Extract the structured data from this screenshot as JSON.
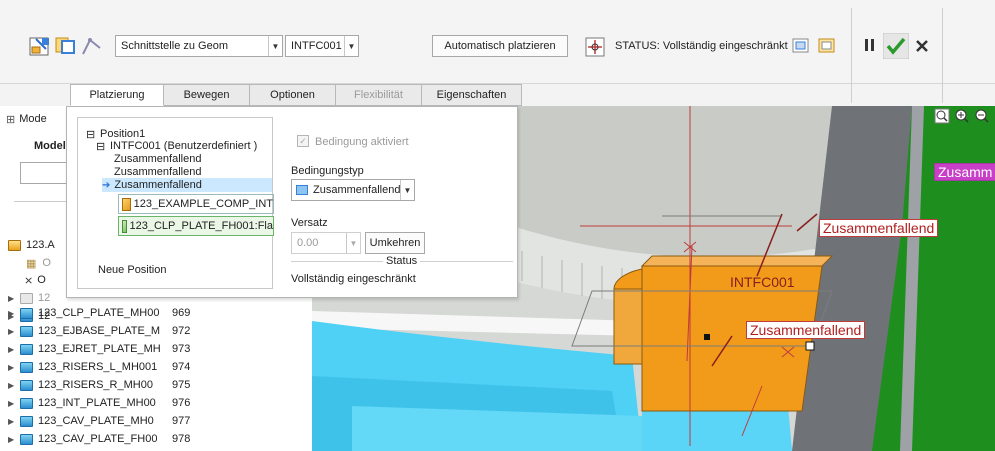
{
  "toolbar": {
    "interface_select": "Schnittstelle zu Geom",
    "intfc_select": "INTFC001",
    "auto_place_label": "Automatisch platzieren",
    "status_label": "STATUS: Vollständig eingeschränkt"
  },
  "tabs": [
    {
      "label": "Platzierung"
    },
    {
      "label": "Bewegen"
    },
    {
      "label": "Optionen"
    },
    {
      "label": "Flexibilität"
    },
    {
      "label": "Eigenschaften"
    }
  ],
  "left_panel": {
    "title_prefix": "Mode",
    "subtitle_prefix": "Model",
    "top_rows": [
      "123.A",
      "O",
      "O",
      "12",
      "12"
    ],
    "rows": [
      {
        "name": "123_CLP_PLATE_MH00",
        "num": "969"
      },
      {
        "name": "123_EJBASE_PLATE_M",
        "num": "972"
      },
      {
        "name": "123_EJRET_PLATE_MH",
        "num": "973"
      },
      {
        "name": "123_RISERS_L_MH001",
        "num": "974"
      },
      {
        "name": "123_RISERS_R_MH00",
        "num": "975"
      },
      {
        "name": "123_INT_PLATE_MH00",
        "num": "976"
      },
      {
        "name": "123_CAV_PLATE_MH0",
        "num": "977"
      },
      {
        "name": "123_CAV_PLATE_FH00",
        "num": "978"
      }
    ]
  },
  "placement": {
    "tree": {
      "position": "Position1",
      "interface": "INTFC001 (Benutzerdefiniert )",
      "constraint1": "Zusammenfallend",
      "constraint2": "Zusammenfallend",
      "constraint3": "Zusammenfallend",
      "ref1": "123_EXAMPLE_COMP_INT",
      "ref2": "123_CLP_PLATE_FH001:Fla",
      "new_position": "Neue Position"
    },
    "constraint_enabled_label": "Bedingung aktiviert",
    "constraint_type_label": "Bedingungstyp",
    "constraint_type_value": "Zusammenfallend",
    "offset_label": "Versatz",
    "offset_value": "0.00",
    "reverse_button": "Umkehren",
    "status_heading": "Status",
    "status_value": "Vollständig eingeschränkt"
  },
  "viewport": {
    "labels": {
      "top_right": "Zusamm",
      "upper": "Zusammenfallend",
      "intfc": "INTFC001",
      "lower": "Zusammenfallend"
    }
  },
  "colors": {
    "accent_orange": "#f29a1a",
    "plate_cyan": "#4fd0f5",
    "green_plate": "#1e8f1e",
    "selection_blue": "#cce8ff",
    "label_red": "#b12020"
  }
}
